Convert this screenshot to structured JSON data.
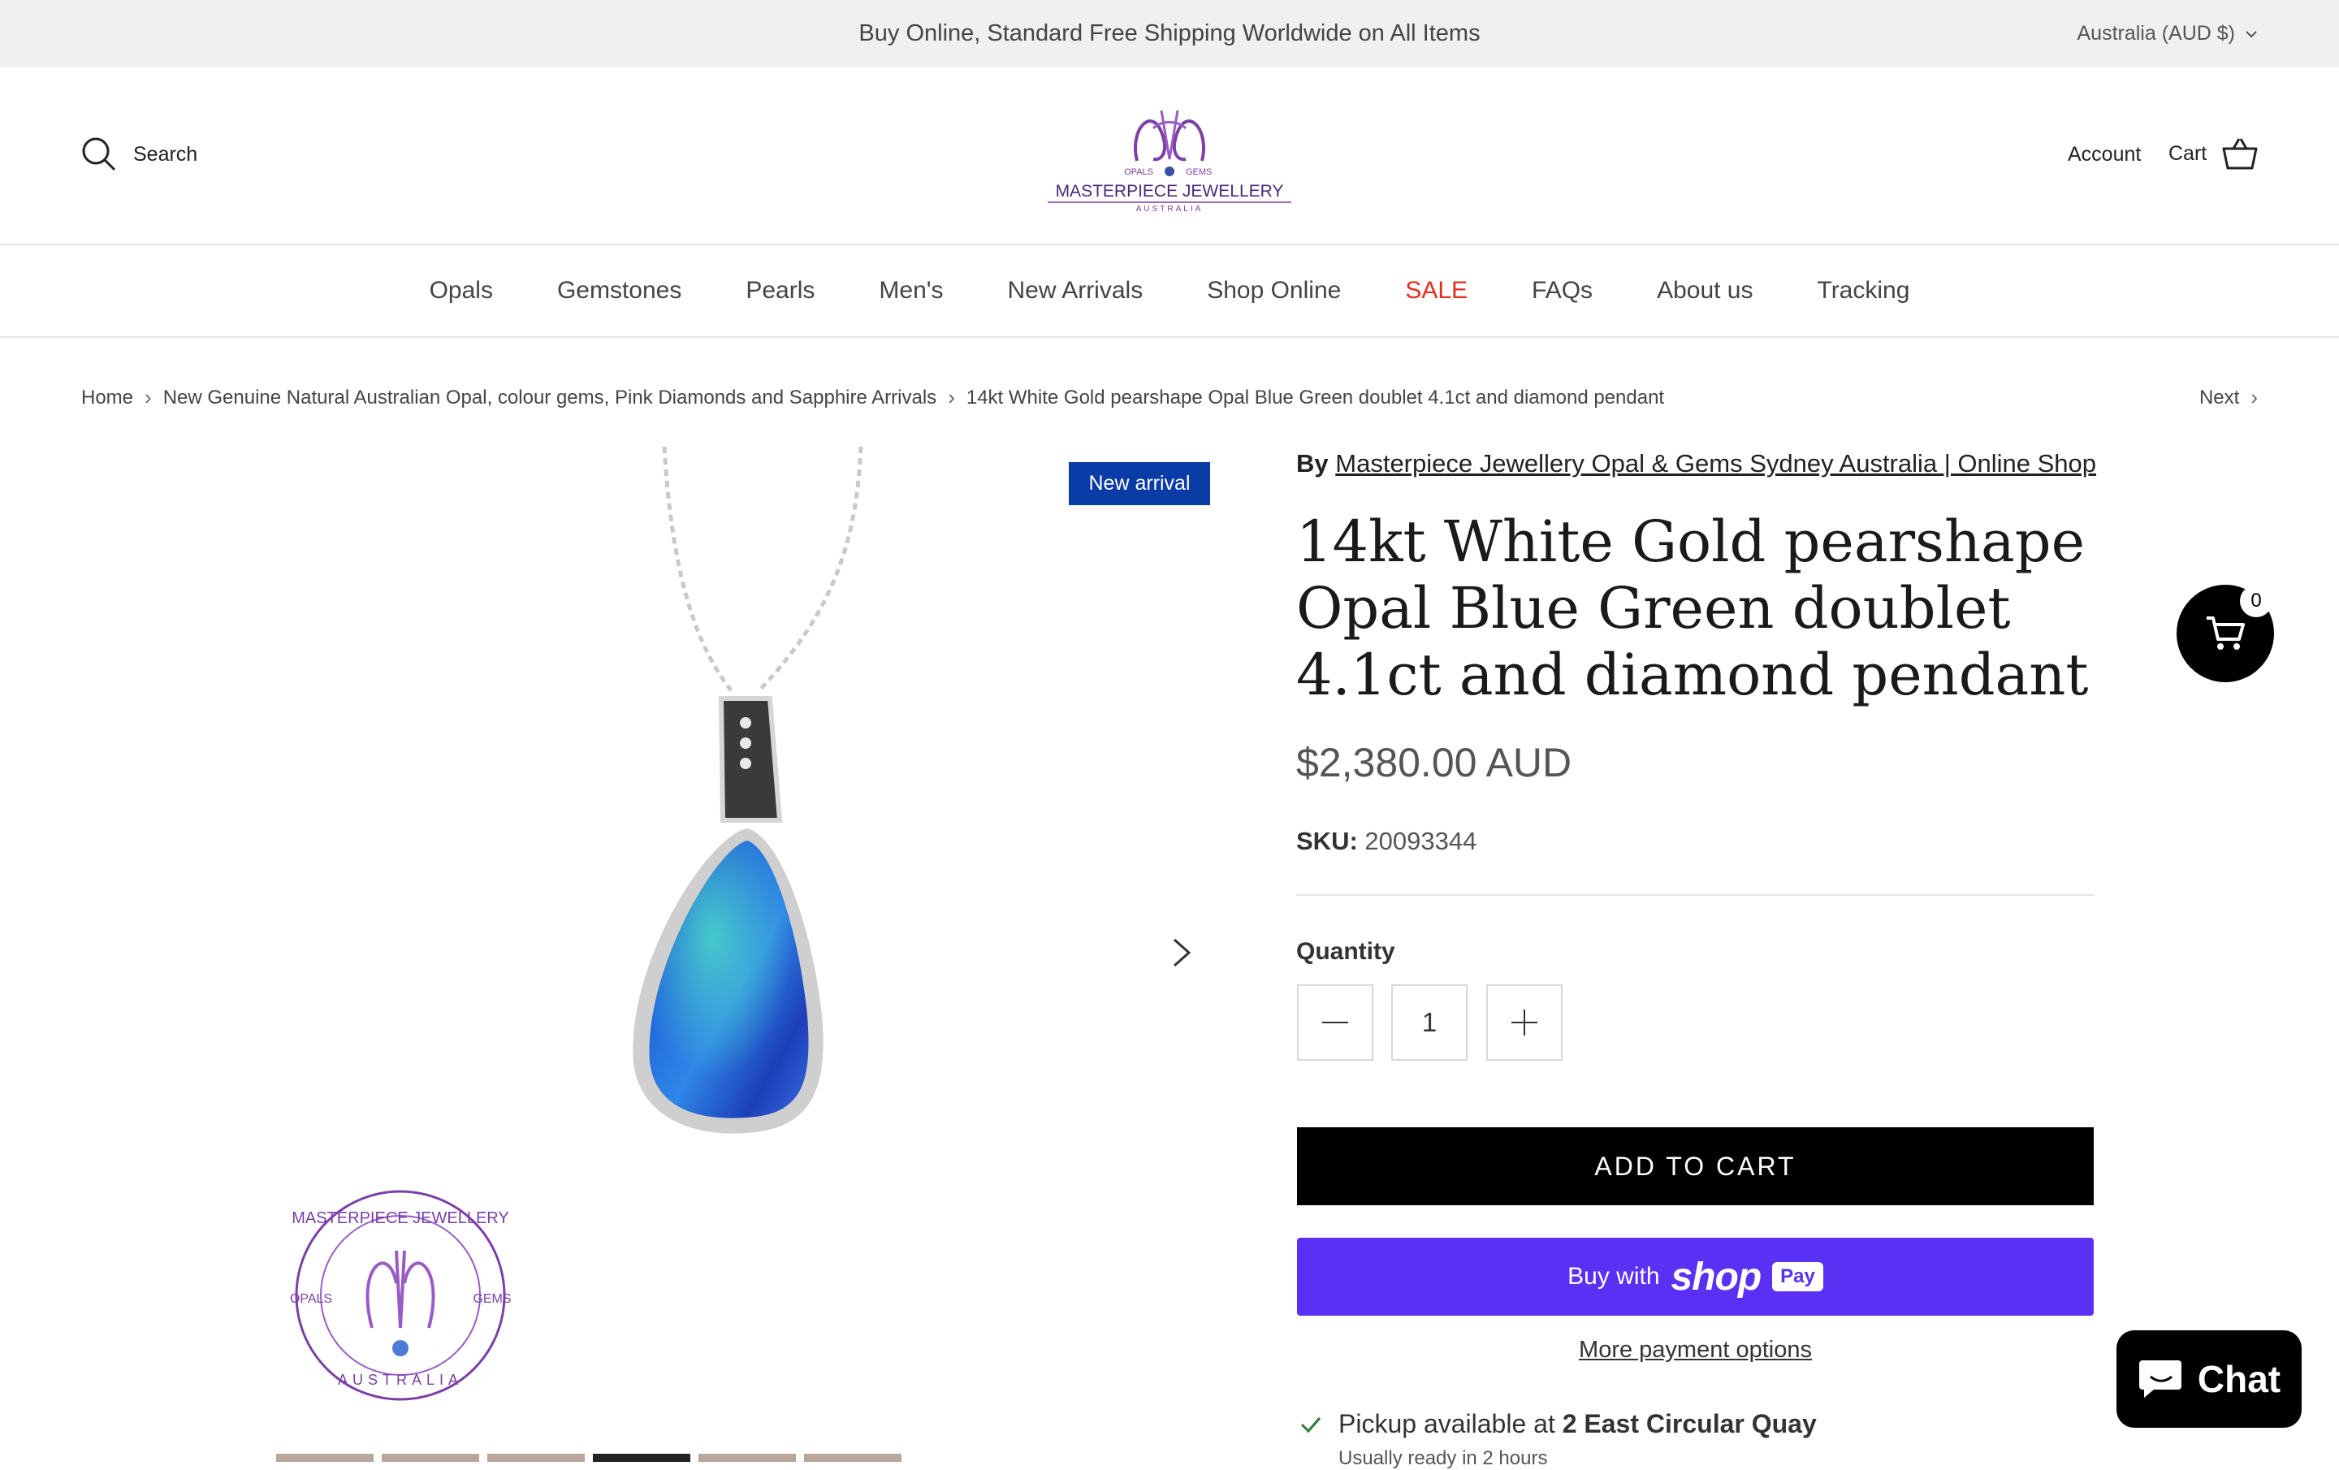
{
  "announcement": {
    "text": "Buy Online, Standard Free Shipping Worldwide on All Items",
    "currency": "Australia (AUD $)"
  },
  "header": {
    "search_label": "Search",
    "logo": {
      "top_left": "OPALS",
      "top_right": "GEMS",
      "name": "MASTERPIECE JEWELLERY",
      "sub": "AUSTRALIA"
    },
    "account_label": "Account",
    "cart_label": "Cart"
  },
  "nav": {
    "items": [
      "Opals",
      "Gemstones",
      "Pearls",
      "Men's",
      "New Arrivals",
      "Shop Online",
      "SALE",
      "FAQs",
      "About us",
      "Tracking"
    ]
  },
  "breadcrumb": {
    "items": [
      "Home",
      "New Genuine Natural Australian Opal, colour gems, Pink Diamonds and Sapphire Arrivals",
      "14kt White Gold pearshape Opal Blue Green doublet 4.1ct and diamond pendant"
    ],
    "next_label": "Next"
  },
  "gallery": {
    "badge": "New arrival",
    "stamp": {
      "top": "MASTERPIECE JEWELLERY",
      "left": "OPALS",
      "right": "GEMS",
      "bottom": "AUSTRALIA"
    }
  },
  "product": {
    "vendor_prefix": "By",
    "vendor": "Masterpiece Jewellery Opal & Gems Sydney Australia | Online Shop",
    "title": "14kt White Gold pearshape Opal Blue Green doublet 4.1ct and diamond pendant",
    "price": "$2,380.00 AUD",
    "sku_label": "SKU:",
    "sku": "20093344",
    "quantity_label": "Quantity",
    "quantity": "1",
    "add_to_cart": "ADD TO CART",
    "shoppay": {
      "buy_with": "Buy with",
      "shop": "shop",
      "pay": "Pay"
    },
    "more_payment": "More payment options",
    "pickup_prefix": "Pickup available at",
    "pickup_location": "2 East Circular Quay",
    "pickup_ready": "Usually ready in 2 hours"
  },
  "floating_cart": {
    "count": "0"
  },
  "chat": {
    "label": "Chat"
  },
  "colors": {
    "announce_bg": "#f0f0f0",
    "badge": "#0a3ca7",
    "sale": "#e0301e",
    "shoppay": "#5a31f4",
    "logo_purple": "#7b3fa6"
  }
}
